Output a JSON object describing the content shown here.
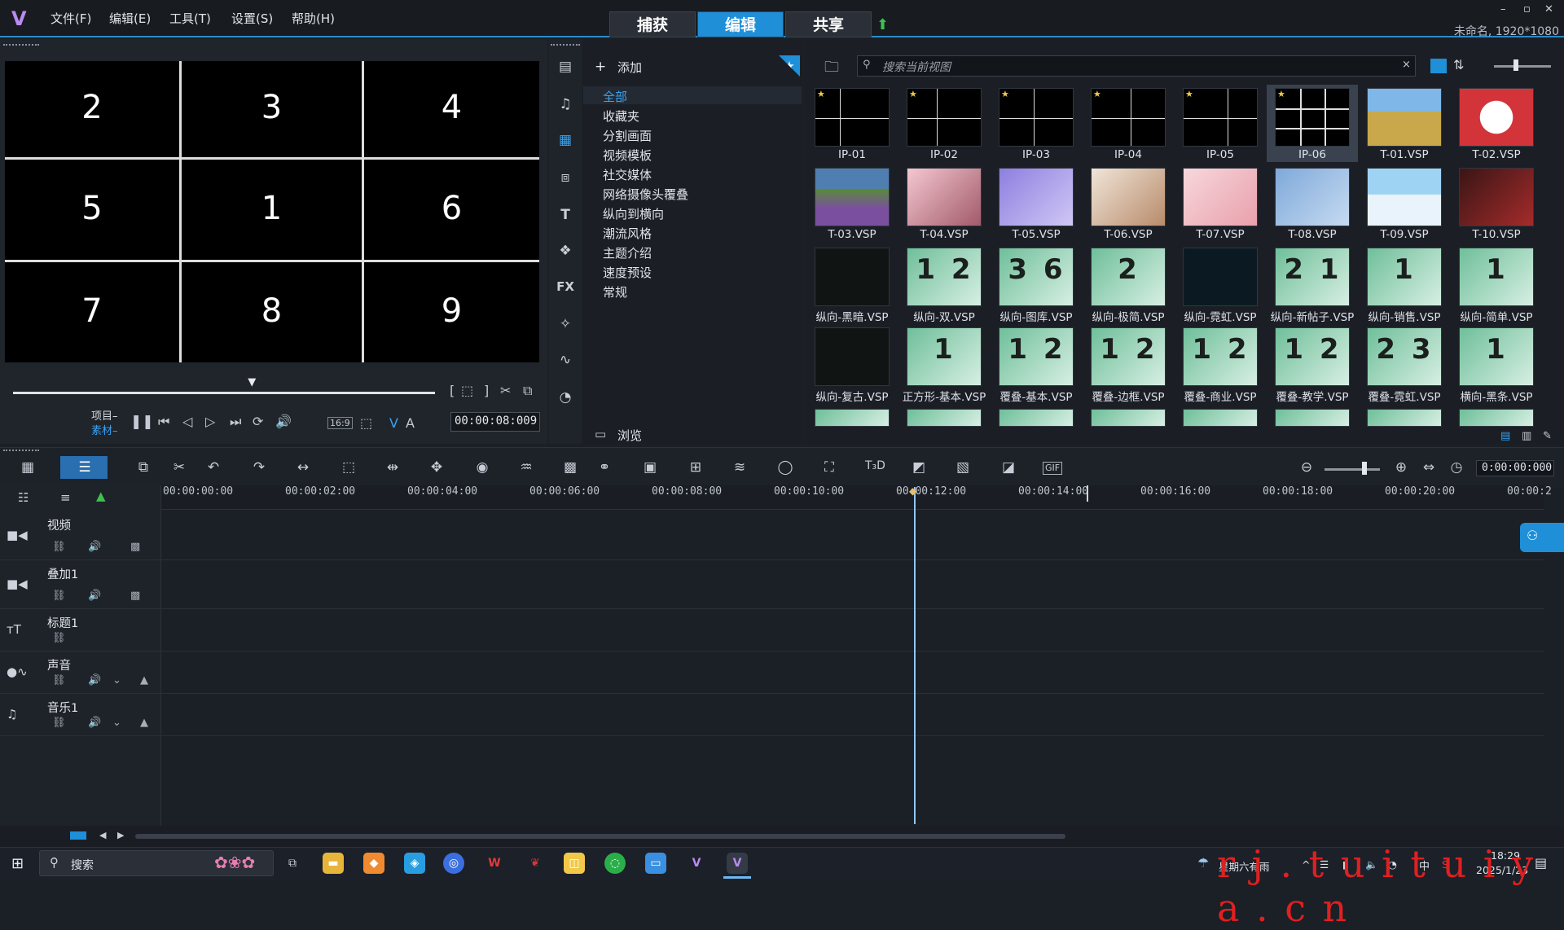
{
  "window": {
    "project_info": "未命名, 1920*1080",
    "controls": [
      "–",
      "▫",
      "✕"
    ]
  },
  "menu": [
    "文件(F)",
    "编辑(E)",
    "工具(T)",
    "设置(S)",
    "帮助(H)"
  ],
  "mode_tabs": [
    {
      "label": "捕获",
      "active": false
    },
    {
      "label": "编辑",
      "active": true
    },
    {
      "label": "共享",
      "active": false
    }
  ],
  "preview": {
    "cells": [
      "2",
      "3",
      "4",
      "5",
      "1",
      "6",
      "7",
      "8",
      "9"
    ],
    "project_label": "项目–",
    "clip_label": "素材–",
    "aspect": "16:9",
    "timecode": "00:00:08:009",
    "scrub_position": 0.57
  },
  "library": {
    "add_label": "添加",
    "browse_label": "浏览",
    "search_placeholder": "搜索当前视图",
    "categories": [
      {
        "label": "全部",
        "active": true
      },
      {
        "label": "收藏夹",
        "active": false
      },
      {
        "label": "分割画面",
        "active": false
      },
      {
        "label": "视频模板",
        "active": false
      },
      {
        "label": "社交媒体",
        "active": false
      },
      {
        "label": "网络摄像头覆叠",
        "active": false
      },
      {
        "label": "纵向到横向",
        "active": false
      },
      {
        "label": "潮流风格",
        "active": false
      },
      {
        "label": "主题介绍",
        "active": false
      },
      {
        "label": "速度预设",
        "active": false
      },
      {
        "label": "常规",
        "active": false
      }
    ],
    "thumbnails": [
      [
        {
          "label": "IP-01",
          "style": "split",
          "selected": false
        },
        {
          "label": "IP-02",
          "style": "split",
          "selected": false
        },
        {
          "label": "IP-03",
          "style": "split",
          "selected": false
        },
        {
          "label": "IP-04",
          "style": "split",
          "selected": false
        },
        {
          "label": "IP-05",
          "style": "split",
          "selected": false
        },
        {
          "label": "IP-06",
          "style": "grid",
          "selected": true
        },
        {
          "label": "T-01.VSP",
          "style": "field",
          "selected": false
        },
        {
          "label": "T-02.VSP",
          "style": "red",
          "selected": false
        }
      ],
      [
        {
          "label": "T-03.VSP",
          "style": "landscape",
          "selected": false
        },
        {
          "label": "T-04.VSP",
          "style": "pink",
          "selected": false
        },
        {
          "label": "T-05.VSP",
          "style": "purple",
          "selected": false
        },
        {
          "label": "T-06.VSP",
          "style": "family",
          "selected": false
        },
        {
          "label": "T-07.VSP",
          "style": "rose",
          "selected": false
        },
        {
          "label": "T-08.VSP",
          "style": "blue",
          "selected": false
        },
        {
          "label": "T-09.VSP",
          "style": "sky",
          "selected": false
        },
        {
          "label": "T-10.VSP",
          "style": "darkred",
          "selected": false
        }
      ],
      [
        {
          "label": "纵向-黑暗.VSP",
          "style": "dark",
          "selected": false
        },
        {
          "label": "纵向-双.VSP",
          "style": "num",
          "selected": false
        },
        {
          "label": "纵向-图库.VSP",
          "style": "num",
          "selected": false
        },
        {
          "label": "纵向-极简.VSP",
          "style": "num",
          "selected": false
        },
        {
          "label": "纵向-霓虹.VSP",
          "style": "neon",
          "selected": false
        },
        {
          "label": "纵向-新帖子.VSP",
          "style": "num",
          "selected": false
        },
        {
          "label": "纵向-销售.VSP",
          "style": "num",
          "selected": false
        },
        {
          "label": "纵向-简单.VSP",
          "style": "num",
          "selected": false
        }
      ],
      [
        {
          "label": "纵向-复古.VSP",
          "style": "dark",
          "selected": false
        },
        {
          "label": "正方形-基本.VSP",
          "style": "num",
          "selected": false
        },
        {
          "label": "覆叠-基本.VSP",
          "style": "num",
          "selected": false
        },
        {
          "label": "覆叠-边框.VSP",
          "style": "num",
          "selected": false
        },
        {
          "label": "覆叠-商业.VSP",
          "style": "num",
          "selected": false
        },
        {
          "label": "覆叠-教学.VSP",
          "style": "num",
          "selected": false
        },
        {
          "label": "覆叠-霓虹.VSP",
          "style": "num",
          "selected": false
        },
        {
          "label": "横向-黑条.VSP",
          "style": "num",
          "selected": false
        }
      ]
    ],
    "thumb_numbers": [
      [
        "",
        "",
        "",
        "",
        "",
        "",
        "",
        ""
      ],
      [
        "",
        "",
        "",
        "",
        "",
        "",
        "",
        ""
      ],
      [
        "",
        "1 2",
        "3 6",
        "2",
        "",
        "2 1",
        "1",
        "1"
      ],
      [
        "",
        "1",
        "1 2",
        "1 2",
        "1 2",
        "1 2",
        "2 3",
        "1"
      ]
    ]
  },
  "timeline": {
    "timecode": "0:00:00:000",
    "ruler": [
      "00:00:00:00",
      "00:00:02:00",
      "00:00:04:00",
      "00:00:06:00",
      "00:00:08:00",
      "00:00:10:00",
      "00:00:12:00",
      "00:00:14:00",
      "00:00:16:00",
      "00:00:18:00",
      "00:00:20:00",
      "00:00:2"
    ],
    "tracks": [
      {
        "name": "视频",
        "icon": "video-icon"
      },
      {
        "name": "叠加1",
        "icon": "overlay-icon"
      },
      {
        "name": "标题1",
        "icon": "title-icon"
      },
      {
        "name": "声音",
        "icon": "voice-icon"
      },
      {
        "name": "音乐1",
        "icon": "music-icon"
      }
    ]
  },
  "taskbar": {
    "search_label": "搜索",
    "weather": "星期六有雨",
    "ime": "中",
    "time": "18:29",
    "date": "2025/1/23"
  },
  "watermark": "r j . t u i t u i y a . c n",
  "colors": {
    "accent": "#1f8fd8",
    "selection": "#3aa3f0",
    "watermark": "#e02020"
  }
}
